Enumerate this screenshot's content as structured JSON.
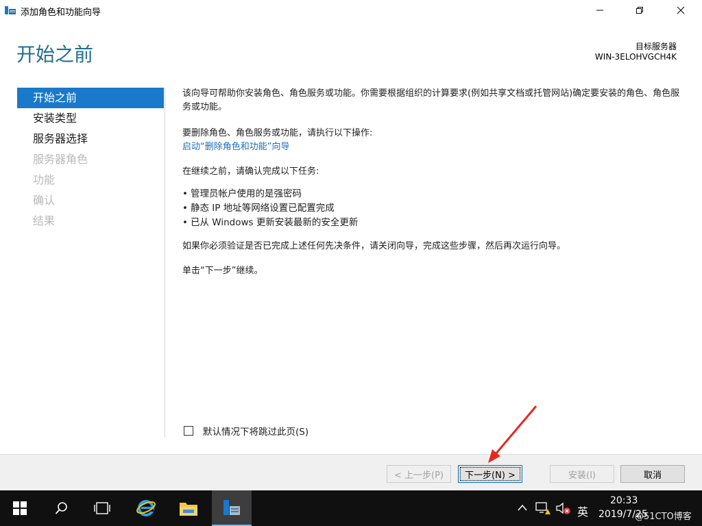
{
  "window": {
    "title": "添加角色和功能向导",
    "minimize_label": "最小化",
    "restore_label": "还原",
    "close_label": "关闭"
  },
  "header": {
    "page_title": "开始之前",
    "target_label": "目标服务器",
    "target_value": "WIN-3ELOHVGCH4K"
  },
  "steps": [
    {
      "label": "开始之前",
      "state": "active"
    },
    {
      "label": "安装类型",
      "state": "enabled"
    },
    {
      "label": "服务器选择",
      "state": "enabled"
    },
    {
      "label": "服务器角色",
      "state": "disabled"
    },
    {
      "label": "功能",
      "state": "disabled"
    },
    {
      "label": "确认",
      "state": "disabled"
    },
    {
      "label": "结果",
      "state": "disabled"
    }
  ],
  "content": {
    "intro": "该向导可帮助你安装角色、角色服务或功能。你需要根据组织的计算要求(例如共享文档或托管网站)确定要安装的角色、角色服务或功能。",
    "remove_heading": "要删除角色、角色服务或功能，请执行以下操作:",
    "remove_link": "启动“删除角色和功能”向导",
    "before_heading": "在继续之前，请确认完成以下任务:",
    "bullets": [
      "管理员帐户使用的是强密码",
      "静态 IP 地址等网络设置已配置完成",
      "已从 Windows 更新安装最新的安全更新"
    ],
    "bullet_char": "•",
    "if_note": "如果你必须验证是否已完成上述任何先决条件，请关闭向导，完成这些步骤，然后再次运行向导。",
    "next_note": "单击“下一步”继续。"
  },
  "skip_checkbox": {
    "label": "默认情况下将跳过此页(S)",
    "checked": false
  },
  "buttons": {
    "prev": "< 上一步(P)",
    "next": "下一步(N) >",
    "install": "安装(I)",
    "cancel": "取消"
  },
  "annotation": {
    "arrow_color": "#e8261e"
  },
  "colors": {
    "accent": "#1979ca",
    "title": "#1d6f8e",
    "link": "#1e6ebe"
  },
  "taskbar": {
    "items": [
      "start-icon",
      "search-icon",
      "task-view-icon",
      "internet-explorer-icon",
      "file-explorer-icon",
      "server-manager-icon"
    ],
    "ime": "英",
    "time": "20:33",
    "date": "2019/7/25",
    "watermark": "@51CTO博客"
  }
}
